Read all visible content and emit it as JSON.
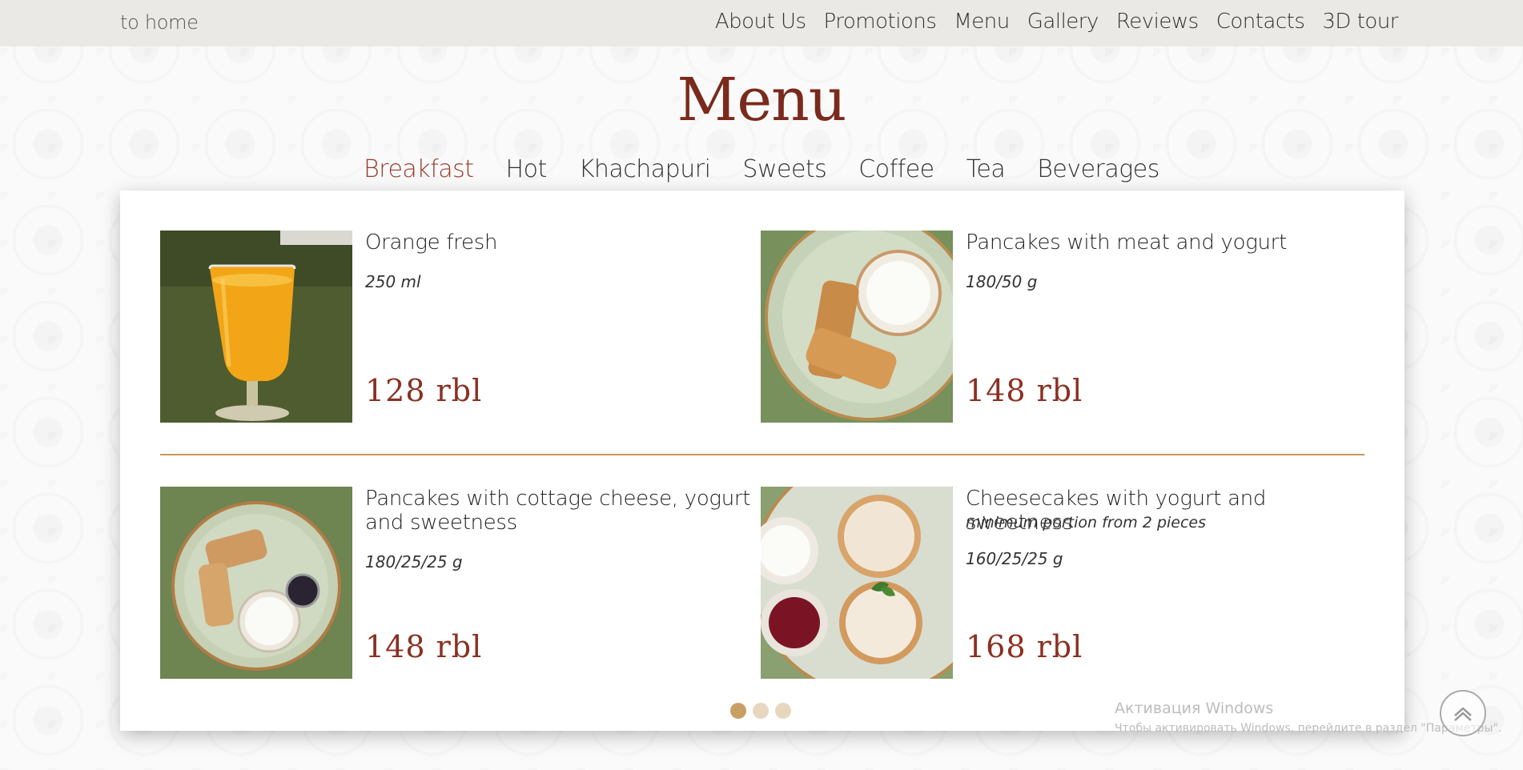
{
  "header": {
    "home_link": "to home",
    "nav": [
      "About Us",
      "Promotions",
      "Menu",
      "Gallery",
      "Reviews",
      "Contacts",
      "3D tour"
    ]
  },
  "page_title": "Menu",
  "tabs": [
    {
      "label": "Breakfast",
      "active": true
    },
    {
      "label": "Hot",
      "active": false
    },
    {
      "label": "Khachapuri",
      "active": false
    },
    {
      "label": "Sweets",
      "active": false
    },
    {
      "label": "Coffee",
      "active": false
    },
    {
      "label": "Tea",
      "active": false
    },
    {
      "label": "Beverages",
      "active": false
    }
  ],
  "items": [
    {
      "name": "Orange fresh",
      "note": "",
      "weight": "250 ml",
      "price": "128  rbl",
      "image": "orange-juice-glass"
    },
    {
      "name": "Pancakes with meat and yogurt",
      "note": "",
      "weight": "180/50 g",
      "price": "148  rbl",
      "image": "pancakes-meat-yogurt-plate"
    },
    {
      "name": "Pancakes with cottage cheese, yogurt and sweetness",
      "note": "",
      "weight": "180/25/25 g",
      "price": "148  rbl",
      "image": "pancakes-cottage-cheese-plate"
    },
    {
      "name": "Cheesecakes with yogurt and sweetness",
      "note": "minimum portion from 2 pieces",
      "weight": "160/25/25 g",
      "price": "168  rbl",
      "image": "cheesecakes-plate"
    }
  ],
  "carousel": {
    "pages": 3,
    "current": 1
  },
  "watermark": {
    "title": "Активация Windows",
    "subtitle": "Чтобы активировать Windows, перейдите в раздел \"Параметры\"."
  },
  "colors": {
    "accent": "#8a3022",
    "divider": "#c79a56",
    "topbar": "#ebe9e5"
  },
  "icons": {
    "scroll_top": "chevron-up-icon"
  }
}
